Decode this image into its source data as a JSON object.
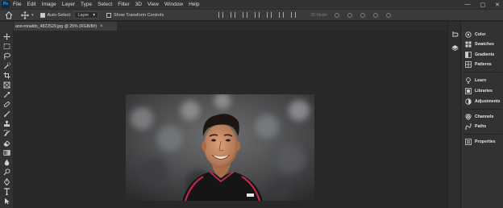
{
  "app": {
    "logo_text": "Ps"
  },
  "menu": [
    "File",
    "Edit",
    "Image",
    "Layer",
    "Type",
    "Select",
    "Filter",
    "3D",
    "View",
    "Window",
    "Help"
  ],
  "window_controls": {
    "minimize": "—",
    "maximize": "▢",
    "close": "✕"
  },
  "options": {
    "auto_select_label": "Auto-Select:",
    "auto_select_checked": true,
    "auto_select_target": "Layer",
    "transform_controls_label": "Show Transform Controls",
    "transform_controls_checked": false,
    "mode_3d_label": "3D Mode:"
  },
  "document": {
    "tab_label": "ano-ronaldo_4822529.jpg @ 25% (RGB/8#)",
    "close": "×"
  },
  "tools": [
    "move-tool",
    "marquee-tool",
    "lasso-tool",
    "quick-select-tool",
    "crop-tool",
    "frame-tool",
    "eyedropper-tool",
    "spot-healing-tool",
    "brush-tool",
    "clone-stamp-tool",
    "history-brush-tool",
    "eraser-tool",
    "gradient-tool",
    "blur-tool",
    "dodge-tool",
    "pen-tool",
    "type-tool",
    "path-select-tool",
    "rectangle-tool"
  ],
  "panels": {
    "group1": [
      "Color",
      "Swatches",
      "Gradients",
      "Patterns"
    ],
    "group2": [
      "Learn",
      "Libraries",
      "Adjustments"
    ],
    "group3": [
      "Channels",
      "Paths"
    ],
    "group4": [
      "Properties"
    ]
  },
  "colors": {
    "accent_blue": "#31a8ff",
    "menubar_bg": "#333333",
    "workspace_bg": "#282828"
  }
}
